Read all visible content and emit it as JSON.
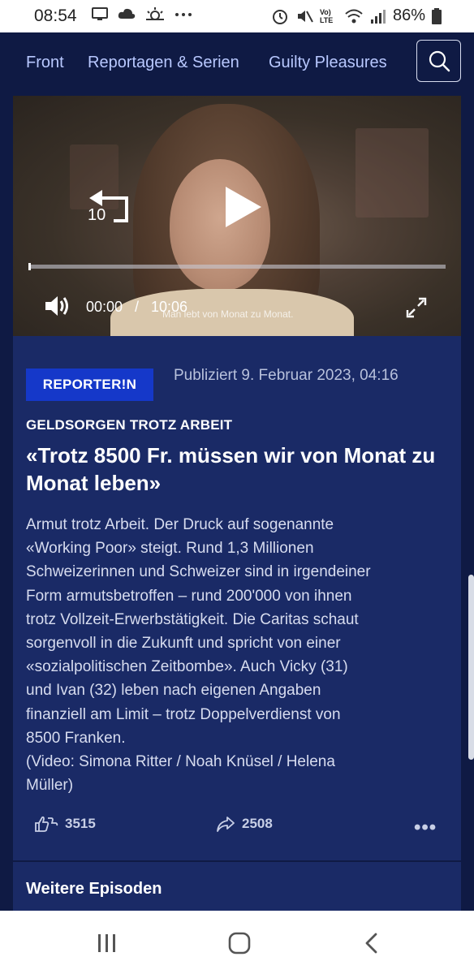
{
  "status_bar": {
    "time": "08:54",
    "left_icons": [
      "screen-icon",
      "cloud-icon",
      "weather-icon",
      "more-dots-icon"
    ],
    "signal_label": "Vo) LTE",
    "battery": "86%"
  },
  "nav": {
    "tabs": [
      {
        "label": "Front"
      },
      {
        "label": "Reportagen & Serien"
      },
      {
        "label": "Guilty Pleasures"
      }
    ],
    "search_icon": "search-icon"
  },
  "video": {
    "replay_seconds": "10",
    "current_time": "00:00",
    "separator": "/",
    "duration": "10:06",
    "subtitle": "Man lebt von Monat zu Monat.",
    "progress": 0
  },
  "article": {
    "badge": "REPORTER!N",
    "published": "Publiziert 9. Februar 2023, 04:16",
    "kicker": "GELDSORGEN TROTZ ARBEIT",
    "headline": "«Trotz 8500 Fr. müssen wir von Monat zu Monat leben»",
    "lead_lines": [
      "Armut trotz Arbeit. Der Druck auf sogenannte",
      "«Working Poor» steigt. Rund 1,3 Millionen",
      "Schweizerinnen und Schweizer sind in irgendeiner",
      "Form armutsbetroffen – rund 200'000 von ihnen",
      "trotz Vollzeit-Erwerbstätigkeit. Die Caritas schaut",
      "sorgenvoll in die Zukunft und spricht von einer",
      "«sozialpolitischen Zeitbombe». Auch Vicky (31)",
      "und Ivan (32) leben nach eigenen Angaben",
      "finanziell am Limit – trotz Doppelverdienst von",
      "8500 Franken.",
      "(Video: Simona Ritter / Noah Knüsel / Helena",
      "Müller)"
    ],
    "reactions": "3515",
    "shares": "2508",
    "more_label": "•••"
  },
  "section": {
    "more_episodes": "Weitere Episoden"
  },
  "colors": {
    "background": "#0f1a44",
    "card": "#1a2a66",
    "badge": "#1538c9",
    "nav_text": "#b8c8ff"
  }
}
